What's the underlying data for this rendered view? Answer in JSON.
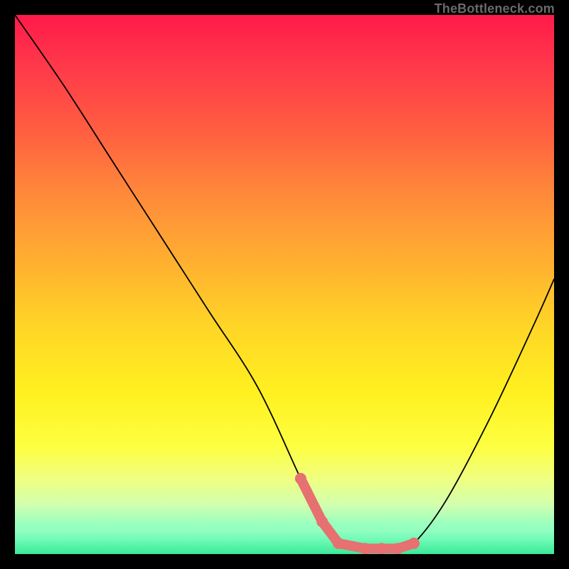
{
  "watermark": "TheBottleneck.com",
  "chart_data": {
    "type": "line",
    "title": "",
    "xlabel": "",
    "ylabel": "",
    "xlim": [
      0,
      100
    ],
    "ylim": [
      0,
      100
    ],
    "series": [
      {
        "name": "bottleneck-curve",
        "x": [
          0,
          9,
          18,
          27,
          36,
          45,
          53,
          57,
          60,
          62,
          65,
          68,
          71,
          74,
          80,
          88,
          96,
          100
        ],
        "y": [
          100,
          87,
          73,
          59,
          45,
          31,
          14,
          6,
          2,
          1,
          1,
          1,
          1,
          2,
          10,
          25,
          42,
          51
        ]
      }
    ],
    "markers": {
      "name": "highlight-points",
      "color": "#e77070",
      "x": [
        53,
        57,
        60,
        65,
        68,
        71,
        74
      ],
      "y": [
        14,
        6,
        2,
        1,
        1,
        1,
        2
      ]
    },
    "gradient_stops": [
      {
        "pos": 0,
        "color": "#ff1a4a"
      },
      {
        "pos": 50,
        "color": "#ffd626"
      },
      {
        "pos": 80,
        "color": "#fdff40"
      },
      {
        "pos": 100,
        "color": "#40f0a0"
      }
    ]
  }
}
